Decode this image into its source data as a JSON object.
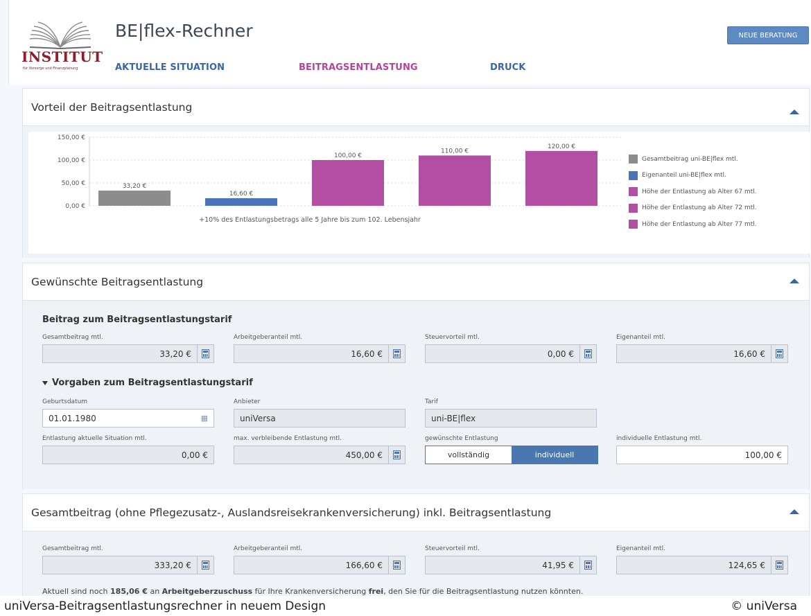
{
  "header": {
    "logo_word": "INSTITUT",
    "logo_tagline": "für Vorsorge und Finanzplanung",
    "title": "BE|flex-Rechner",
    "nav": [
      {
        "label": "AKTUELLE SITUATION",
        "active": false
      },
      {
        "label": "BEITRAGSENTLASTUNG",
        "active": true
      },
      {
        "label": "DRUCK",
        "active": false
      }
    ],
    "new_button": "NEUE BERATUNG"
  },
  "colors": {
    "accent_blue": "#4b77b1",
    "accent_magenta": "#b5449a",
    "bar_gray": "#8c8c8c",
    "bar_blue": "#4b73b9",
    "bar_magenta": "#b24fa2"
  },
  "panel1": {
    "title": "Vorteil der Beitragsentlastung"
  },
  "chart_data": {
    "type": "bar",
    "categories": [
      "Gesamtbeitrag uni-BE|flex mtl.",
      "Eigenanteil uni-BE|flex mtl.",
      "Höhe der Entlastung ab Alter 67 mtl.",
      "Höhe der Entlastung ab Alter 72 mtl.",
      "Höhe der Entlastung ab Alter 77 mtl."
    ],
    "values": [
      33.2,
      16.6,
      100.0,
      110.0,
      120.0
    ],
    "data_labels": [
      "33,20 €",
      "16,60 €",
      "100,00 €",
      "110,00 €",
      "120,00 €"
    ],
    "bar_colors": [
      "#8c8c8c",
      "#4b73b9",
      "#b24fa2",
      "#b24fa2",
      "#b24fa2"
    ],
    "y_ticks": [
      "0,00 €",
      "50,00 €",
      "100,00 €",
      "150,00 €"
    ],
    "ylim": [
      0,
      150
    ],
    "grid": true,
    "legend_position": "right",
    "legend": [
      {
        "label": "Gesamtbeitrag uni-BE|flex mtl.",
        "color": "#8c8c8c"
      },
      {
        "label": "Eigenanteil uni-BE|flex mtl.",
        "color": "#4b73b9"
      },
      {
        "label": "Höhe der Entlastung ab Alter 67 mtl.",
        "color": "#b24fa2"
      },
      {
        "label": "Höhe der Entlastung ab Alter 72 mtl.",
        "color": "#b24fa2"
      },
      {
        "label": "Höhe der Entlastung ab Alter 77 mtl.",
        "color": "#b24fa2"
      }
    ],
    "annotation": "+10% des Entlastungsbetrags alle 5 Jahre bis zum 102. Lebensjahr"
  },
  "panel2": {
    "title": "Gewünschte Beitragsentlastung",
    "section_title": "Beitrag zum Beitragsentlastungstarif",
    "fields": [
      {
        "label": "Gesamtbeitrag mtl.",
        "value": "33,20 €"
      },
      {
        "label": "Arbeitgeberanteil mtl.",
        "value": "16,60 €"
      },
      {
        "label": "Steuervorteil mtl.",
        "value": "0,00 €"
      },
      {
        "label": "Eigenanteil mtl.",
        "value": "16,60 €"
      }
    ],
    "subsection_title": "Vorgaben zum Beitragsentlastungstarif",
    "geburtsdatum": {
      "label": "Geburtsdatum",
      "value": "01.01.1980"
    },
    "anbieter": {
      "label": "Anbieter",
      "value": "uniVersa"
    },
    "tarif": {
      "label": "Tarif",
      "value": "uni-BE|flex"
    },
    "entlastung_aktuell": {
      "label": "Entlastung aktuelle Situation mtl.",
      "value": "0,00 €"
    },
    "max_entlastung": {
      "label": "max. verbleibende Entlastung mtl.",
      "value": "450,00 €"
    },
    "gewuenschte": {
      "label": "gewünschte Entlastung",
      "options": [
        "vollständig",
        "individuell"
      ],
      "selected": "individuell"
    },
    "individuelle": {
      "label": "individuelle Entlastung mtl.",
      "value": "100,00 €"
    }
  },
  "panel3": {
    "title": "Gesamtbeitrag (ohne Pflegezusatz-, Auslandsreisekrankenversicherung) inkl. Beitragsentlastung",
    "fields": [
      {
        "label": "Gesamtbeitrag mtl.",
        "value": "333,20 €"
      },
      {
        "label": "Arbeitgeberanteil mtl.",
        "value": "166,60 €"
      },
      {
        "label": "Steuervorteil mtl.",
        "value": "41,95 €"
      },
      {
        "label": "Eigenanteil mtl.",
        "value": "124,65 €"
      }
    ],
    "note_pre": "Aktuell sind noch ",
    "note_amount": "185,06 €",
    "note_mid1": " an ",
    "note_employer": "Arbeitgeberzuschuss",
    "note_mid2": " für Ihre Krankenversicherung ",
    "note_free": "frei",
    "note_post": ", den Sie für die Beitragsentlastung nutzen könnten."
  },
  "caption": {
    "left": "uniVersa-Beitragsentlastungsrechner in neuem Design",
    "right": "© uniVersa"
  }
}
